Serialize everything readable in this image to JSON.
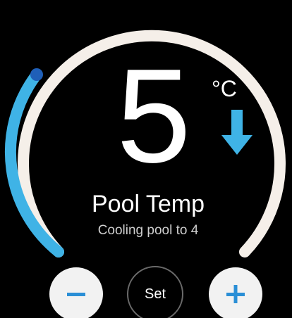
{
  "thermostat": {
    "temperature": "5",
    "unit": "°C",
    "name": "Pool Temp",
    "status": "Cooling pool to 4",
    "trend": "cooling",
    "trend_icon": "arrow-down-icon"
  },
  "dial": {
    "track_color": "#f5efe9",
    "fill_color": "#3fb3e6",
    "marker_color": "#1f5fb8",
    "fill_level_percent": 35
  },
  "controls": {
    "decrease_icon": "minus-icon",
    "set_label": "Set",
    "increase_icon": "plus-icon",
    "icon_color": "#2b8fd6"
  }
}
